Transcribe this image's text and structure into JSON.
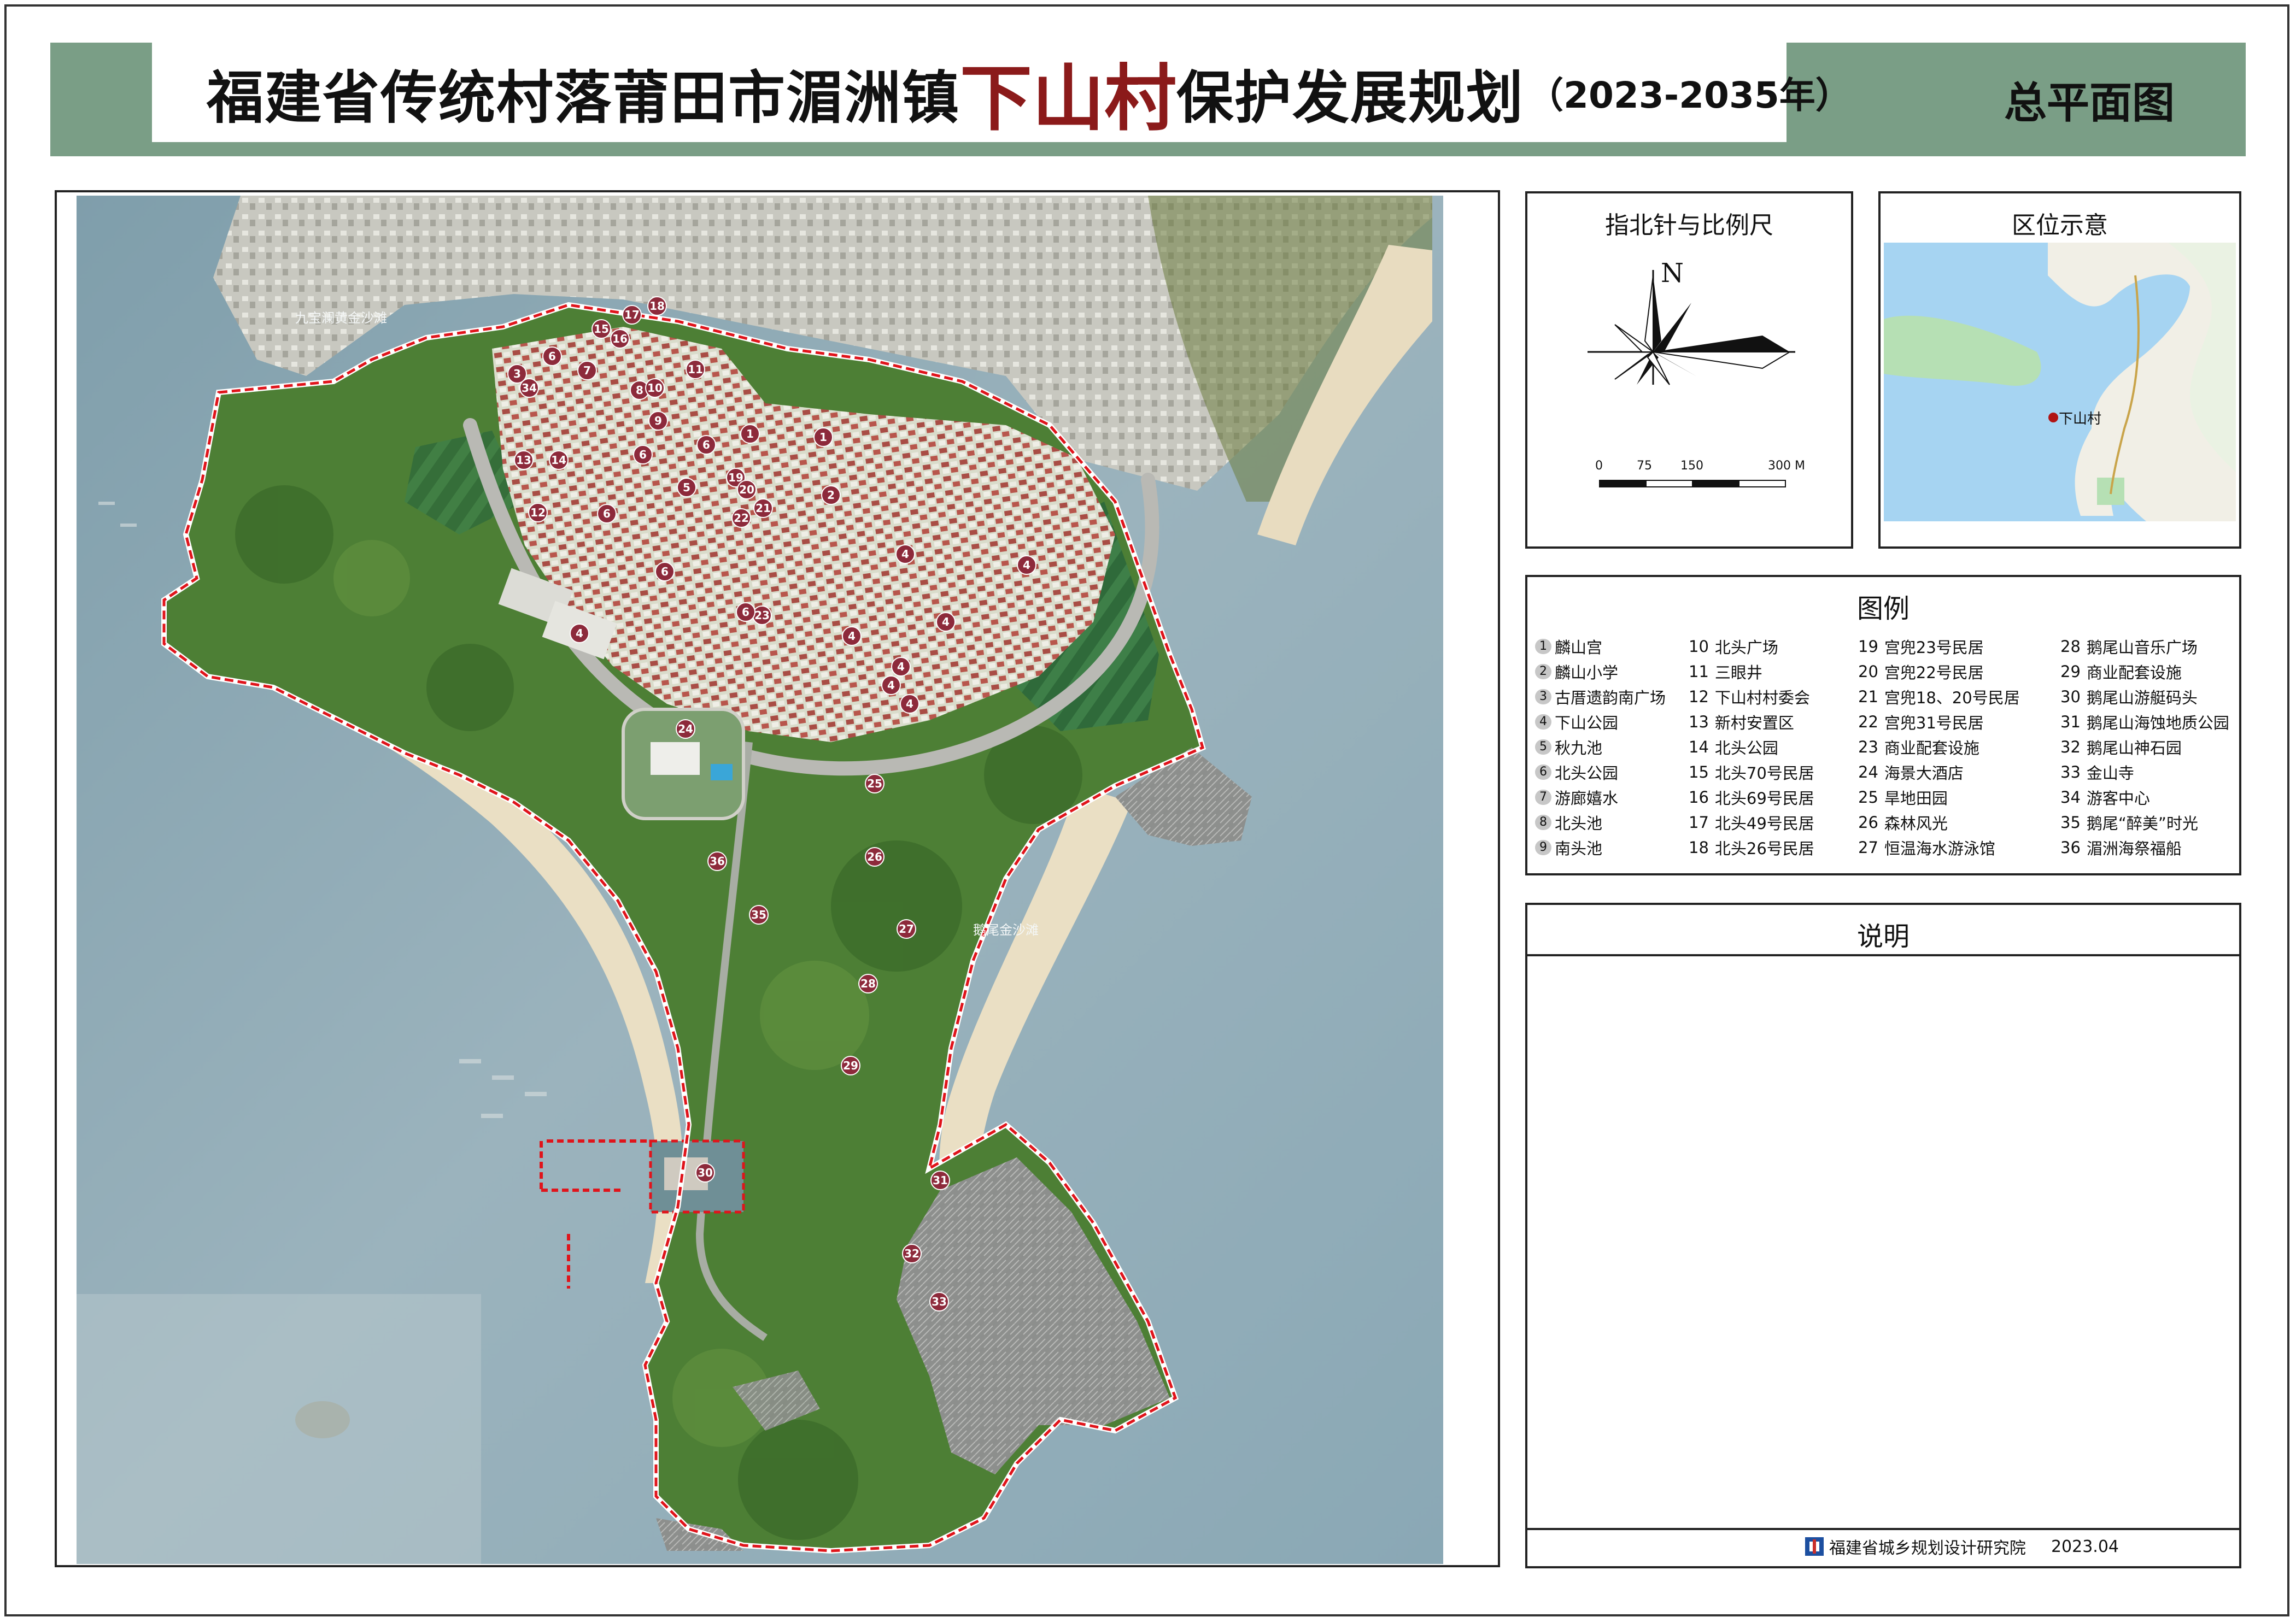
{
  "header": {
    "title_prefix": "福建省传统村落莆田市湄洲镇",
    "title_village": "下山村",
    "title_suffix": "保护发展规划",
    "title_years": "（2023-2035年）",
    "sheet_title": "总平面图"
  },
  "map": {
    "labels": {
      "west_beach": "九宝澜黄金沙滩",
      "east_beach": "鹅尾金沙滩"
    },
    "markers": [
      "1",
      "2",
      "3",
      "4",
      "5",
      "6",
      "7",
      "8",
      "9",
      "10",
      "11",
      "12",
      "13",
      "14",
      "15",
      "16",
      "17",
      "18",
      "19",
      "20",
      "21",
      "22",
      "23",
      "24",
      "25",
      "26",
      "27",
      "28",
      "29",
      "30",
      "31",
      "32",
      "33",
      "34",
      "35",
      "36"
    ],
    "colors": {
      "sea": "#8fa9b5",
      "land": "#4d7f35",
      "boundary": "#e0141b",
      "marker": "#8d2a3b"
    }
  },
  "compass": {
    "title": "指北针与比例尺",
    "north": "N",
    "scale_ticks": [
      "0",
      "75",
      "150",
      "300 M"
    ]
  },
  "location": {
    "title": "区位示意",
    "village": "下山村"
  },
  "legend": {
    "title": "图例",
    "items": [
      {
        "num": "1",
        "name": "麟山宫"
      },
      {
        "num": "2",
        "name": "麟山小学"
      },
      {
        "num": "3",
        "name": "古厝遗韵南广场"
      },
      {
        "num": "4",
        "name": "下山公园"
      },
      {
        "num": "5",
        "name": "秋九池"
      },
      {
        "num": "6",
        "name": "北头公园"
      },
      {
        "num": "7",
        "name": "游廊嬉水"
      },
      {
        "num": "8",
        "name": "北头池"
      },
      {
        "num": "9",
        "name": "南头池"
      },
      {
        "num": "10",
        "name": "北头广场"
      },
      {
        "num": "11",
        "name": "三眼井"
      },
      {
        "num": "12",
        "name": "下山村村委会"
      },
      {
        "num": "13",
        "name": "新村安置区"
      },
      {
        "num": "14",
        "name": "北头公园"
      },
      {
        "num": "15",
        "name": "北头70号民居"
      },
      {
        "num": "16",
        "name": "北头69号民居"
      },
      {
        "num": "17",
        "name": "北头49号民居"
      },
      {
        "num": "18",
        "name": "北头26号民居"
      },
      {
        "num": "19",
        "name": "宫兜23号民居"
      },
      {
        "num": "20",
        "name": "宫兜22号民居"
      },
      {
        "num": "21",
        "name": "宫兜18、20号民居"
      },
      {
        "num": "22",
        "name": "宫兜31号民居"
      },
      {
        "num": "23",
        "name": "商业配套设施"
      },
      {
        "num": "24",
        "name": "海景大酒店"
      },
      {
        "num": "25",
        "name": "旱地田园"
      },
      {
        "num": "26",
        "name": "森林风光"
      },
      {
        "num": "27",
        "name": "恒温海水游泳馆"
      },
      {
        "num": "28",
        "name": "鹅尾山音乐广场"
      },
      {
        "num": "29",
        "name": "商业配套设施"
      },
      {
        "num": "30",
        "name": "鹅尾山游艇码头"
      },
      {
        "num": "31",
        "name": "鹅尾山海蚀地质公园"
      },
      {
        "num": "32",
        "name": "鹅尾山神石园"
      },
      {
        "num": "33",
        "name": "金山寺"
      },
      {
        "num": "34",
        "name": "游客中心"
      },
      {
        "num": "35",
        "name": "鹅尾“醉美”时光"
      },
      {
        "num": "36",
        "name": "湄洲海祭福船"
      }
    ]
  },
  "notes": {
    "title": "说明",
    "org": "福建省城乡规划设计研究院",
    "date": "2023.04"
  }
}
